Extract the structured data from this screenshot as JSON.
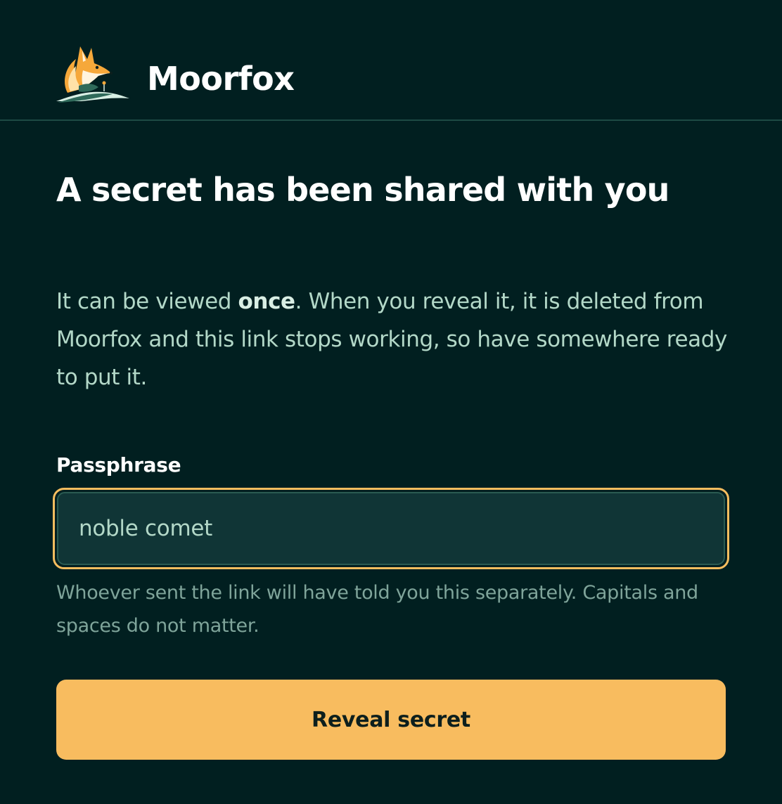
{
  "brand": {
    "name": "Moorfox",
    "logo_icon": "fox-logo-icon"
  },
  "main": {
    "title": "A secret has been shared with you",
    "description": {
      "part1": "It can be viewed ",
      "emphasis": "once",
      "part2": ". When you reveal it, it is deleted from Moorfox and this link stops working, so have somewhere ready to put it."
    },
    "passphrase": {
      "label": "Passphrase",
      "value": "noble comet",
      "hint": "Whoever sent the link will have told you this separately. Capitals and spaces do not matter."
    },
    "reveal_button_label": "Reveal secret"
  },
  "colors": {
    "background": "#011f20",
    "accent": "#f8bc5f",
    "input_background": "#103536",
    "text_muted": "#b3d8c8",
    "hint_text": "#7fa49a",
    "divider": "#1d4a44"
  }
}
